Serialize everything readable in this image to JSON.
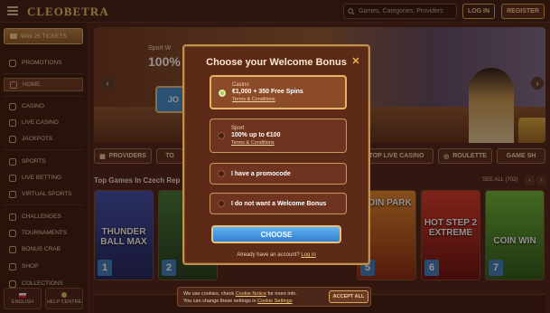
{
  "header": {
    "logo": "CLEOBETRA",
    "search_placeholder": "Games, Categories, Providers",
    "login_label": "LOG IN",
    "register_label": "REGISTER"
  },
  "sidebar": {
    "win_tickets": "WIN 25 TICKETS",
    "items": [
      {
        "label": "PROMOTIONS",
        "icon": "gift-icon"
      },
      {
        "label": "HOME",
        "icon": "home-icon"
      },
      {
        "label": "CASINO",
        "icon": "casino-icon"
      },
      {
        "label": "LIVE CASINO",
        "icon": "live-casino-icon"
      },
      {
        "label": "JACKPOTS",
        "icon": "jackpot-icon"
      },
      {
        "label": "SPORTS",
        "icon": "sports-icon"
      },
      {
        "label": "LIVE BETTING",
        "icon": "live-betting-icon"
      },
      {
        "label": "VIRTUAL SPORTS",
        "icon": "virtual-sports-icon"
      },
      {
        "label": "CHALLENGES",
        "icon": "challenges-icon"
      },
      {
        "label": "TOURNAMENTS",
        "icon": "tournaments-icon"
      },
      {
        "label": "BONUS CRAB",
        "icon": "crab-icon"
      },
      {
        "label": "SHOP",
        "icon": "shop-icon"
      },
      {
        "label": "COLLECTIONS",
        "icon": "collections-icon"
      }
    ],
    "language_label": "ENGLISH",
    "help_label": "HELP CENTRE"
  },
  "hero": {
    "subtitle": "Sport W",
    "headline": "100%",
    "button_text": "JO"
  },
  "categories": [
    {
      "label": "PROVIDERS"
    },
    {
      "label": "TO"
    },
    {
      "label": "TOP LIVE CASINO"
    },
    {
      "label": "ROULETTE"
    },
    {
      "label": "GAME SH"
    }
  ],
  "games_section": {
    "title": "Top Games In Czech Rep",
    "see_all": "SEE ALL (702)",
    "games": [
      {
        "rank": "1",
        "title": "THUNDER BALL MAX",
        "color": "#2e3f8f"
      },
      {
        "rank": "2",
        "title": "",
        "color": "#2d5a2a"
      },
      {
        "rank": "5",
        "title": "COIN PARK",
        "color": "#c7511e"
      },
      {
        "rank": "6",
        "title": "HOT STEP 2 EXTREME",
        "color": "#b41f1f"
      },
      {
        "rank": "7",
        "title": "COIN WIN",
        "color": "#3b6d2a"
      }
    ]
  },
  "modal": {
    "title": "Choose your Welcome Bonus",
    "options": [
      {
        "category": "Casino",
        "title": "€1,000 + 350 Free Spins",
        "terms": "Terms & Conditions",
        "selected": true
      },
      {
        "category": "Sport",
        "title": "100% up to €100",
        "terms": "Terms & Conditions",
        "selected": false
      },
      {
        "category": "",
        "title": "I have a promocode",
        "terms": "",
        "selected": false
      },
      {
        "category": "",
        "title": "I do not want a Welcome Bonus",
        "terms": "",
        "selected": false
      }
    ],
    "choose_label": "CHOOSE",
    "account_text": "Already have an account?",
    "login_link": "Log in"
  },
  "cookie": {
    "line1_a": "We use cookies, check ",
    "line1_link": "Cookie Notice",
    "line1_b": " for more info.",
    "line2_a": "You can change these settings in ",
    "line2_link": "Cookie Settings",
    "accept_label": "ACCEPT ALL"
  },
  "colors": {
    "accent": "#c39148",
    "primary_button": "#3b8fd8",
    "selected_radio": "#9ed34a"
  }
}
